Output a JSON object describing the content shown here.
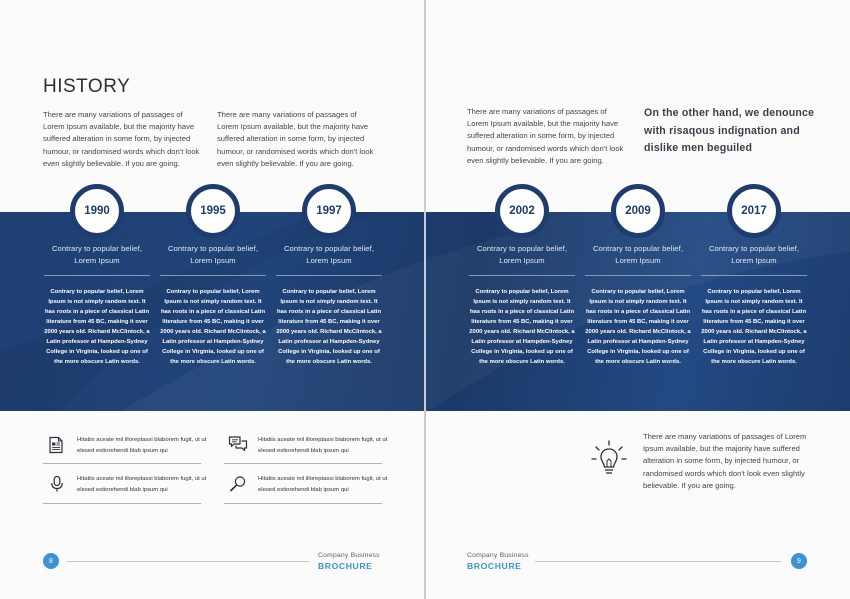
{
  "left_page": {
    "heading": "HISTORY",
    "intro_left": "There are many variations of passages of Lorem Ipsum available, but the majority have suffered alteration in some form, by injected humour, or randomised words which don't look even slightly believable. If you are going.",
    "intro_right": "There are many variations of passages of Lorem Ipsum available, but the majority have suffered alteration in some form, by injected humour, or randomised words which don't look even slightly believable. If you are going.",
    "page_number": "8",
    "footer_company": "Company Business",
    "footer_brand": "BROCHURE"
  },
  "right_page": {
    "intro": "There are many variations of passages of Lorem Ipsum available, but the majority have suffered alteration in some form, by injected humour, or randomised words which don't look even slightly believable. If you are going.",
    "quote": "On the other hand, we denounce with risaqous indignation and dislike men beguiled",
    "tip_text": "There are many variations of passages of Lorem Ipsum available, but the majority have suffered alteration in some form, by injected humour, or randomised words which don't look even slightly believable. If you are going.",
    "page_number": "9",
    "footer_company": "Company Business",
    "footer_brand": "BROCHURE"
  },
  "timeline": [
    {
      "year": "1990",
      "title": "Contrary to popular belief, Lorem Ipsum",
      "body": "Contrary to popular belief, Lorem Ipsum is not simply random text. It has roots in a piece of classical Latin literature from 45 BC, making it over 2000 years old. Richard McClintock, a Latin professor at Hampden-Sydney College in Virginia, looked up one of the more obscure Latin words."
    },
    {
      "year": "1995",
      "title": "Contrary to popular belief, Lorem Ipsum",
      "body": "Contrary to popular belief, Lorem Ipsum is not simply random text. It has roots in a piece of classical Latin literature from 45 BC, making it over 2000 years old. Richard McClintock, a Latin professor at Hampden-Sydney College in Virginia, looked up one of the more obscure Latin words."
    },
    {
      "year": "1997",
      "title": "Contrary to popular belief, Lorem Ipsum",
      "body": "Contrary to popular belief, Lorem Ipsum is not simply random text. It has roots in a piece of classical Latin literature from 45 BC, making it over 2000 years old. Richard McClintock, a Latin professor at Hampden-Sydney College in Virginia, looked up one of the more obscure Latin words."
    },
    {
      "year": "2002",
      "title": "Contrary to popular belief, Lorem Ipsum",
      "body": "Contrary to popular belief, Lorem Ipsum is not simply random text. It has roots in a piece of classical Latin literature from 45 BC, making it over 2000 years old. Richard McClintock, a Latin professor at Hampden-Sydney College in Virginia, looked up one of the more obscure Latin words."
    },
    {
      "year": "2009",
      "title": "Contrary to popular belief, Lorem Ipsum",
      "body": "Contrary to popular belief, Lorem Ipsum is not simply random text. It has roots in a piece of classical Latin literature from 45 BC, making it over 2000 years old. Richard McClintock, a Latin professor at Hampden-Sydney College in Virginia, looked up one of the more obscure Latin words."
    },
    {
      "year": "2017",
      "title": "Contrary to popular belief, Lorem Ipsum",
      "body": "Contrary to popular belief, Lorem Ipsum is not simply random text. It has roots in a piece of classical Latin literature from 45 BC, making it over 2000 years old. Richard McClintock, a Latin professor at Hampden-Sydney College in Virginia, looked up one of the more obscure Latin words."
    }
  ],
  "features": [
    {
      "icon": "document-icon",
      "text": "Hitatiis aceate mil illoreptassi blaborem fugit, ut ut elesed estiorehendi blab ipsum qui"
    },
    {
      "icon": "chat-bubbles-icon",
      "text": "Hitatiis aceate mil illoreptassi blaborem fugit, ut ut elesed estiorehendi blab ipsum qui"
    },
    {
      "icon": "microphone-icon",
      "text": "Hitatiis aceate mil illoreptassi blaborem fugit, ut ut elesed estiorehendi blab ipsum qui"
    },
    {
      "icon": "magnifier-icon",
      "text": "Hitatiis aceate mil illoreptassi blaborem fugit, ut ut elesed estiorehendi blab ipsum qui"
    }
  ],
  "colors": {
    "band": "#1f3f72",
    "accent": "#3a92d9",
    "year_text": "#1e3c6e"
  }
}
